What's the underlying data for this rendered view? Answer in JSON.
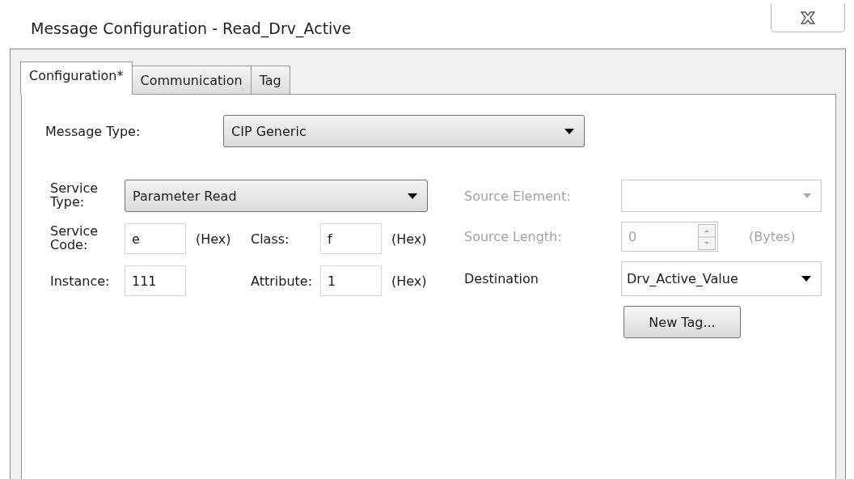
{
  "window": {
    "title": "Message Configuration - Read_Drv_Active"
  },
  "tabs": [
    {
      "label": "Configuration*",
      "selected": true
    },
    {
      "label": "Communication",
      "selected": false
    },
    {
      "label": "Tag",
      "selected": false
    }
  ],
  "message_type": {
    "label": "Message Type:",
    "value": "CIP Generic"
  },
  "service_type": {
    "label": "Service Type:",
    "value": "Parameter Read"
  },
  "service_code": {
    "label": "Service Code:",
    "value": "e",
    "unit": "(Hex)"
  },
  "class": {
    "label": "Class:",
    "value": "f",
    "unit": "(Hex)"
  },
  "instance": {
    "label": "Instance:",
    "value": "111"
  },
  "attribute": {
    "label": "Attribute:",
    "value": "1",
    "unit": "(Hex)"
  },
  "source_element": {
    "label": "Source Element:",
    "disabled": true
  },
  "source_length": {
    "label": "Source Length:",
    "value": "0",
    "unit": "(Bytes)",
    "disabled": true
  },
  "destination": {
    "label": "Destination",
    "value": "Drv_Active_Value"
  },
  "new_tag_button": "New Tag..."
}
